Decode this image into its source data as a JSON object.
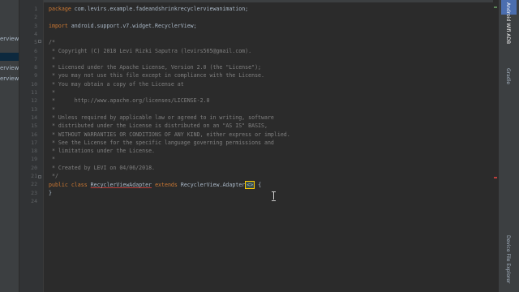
{
  "project_panel": {
    "items": [
      "erviewa",
      "erviewa",
      "erviewa"
    ]
  },
  "right_toolbar": {
    "tabs": [
      "Android Wifi ADB",
      "Gradle",
      "Device File Explorer"
    ]
  },
  "editor": {
    "line_numbers": [
      "1",
      "2",
      "3",
      "4",
      "5",
      "6",
      "7",
      "8",
      "9",
      "10",
      "11",
      "12",
      "13",
      "14",
      "15",
      "16",
      "17",
      "18",
      "19",
      "20",
      "21",
      "22",
      "23",
      "24"
    ],
    "package_keyword": "package",
    "package_name": " com.levirs.example.fadeandshrinkrecyclerviewanimation;",
    "import_keyword": "import",
    "import_name": " android.support.v7.widget.RecyclerView;",
    "comment_lines": [
      "/*",
      " * Copyright (C) 2018 Levi Rizki Saputra (levirs565@gmail.com).",
      " *",
      " * Licensed under the Apache License, Version 2.0 (the \"License\");",
      " * you may not use this file except in compliance with the License.",
      " * You may obtain a copy of the License at",
      " *",
      " *      http://www.apache.org/licenses/LICENSE-2.0",
      " *",
      " * Unless required by applicable law or agreed to in writing, software",
      " * distributed under the License is distributed on an \"AS IS\" BASIS,",
      " * WITHOUT WARRANTIES OR CONDITIONS OF ANY KIND, either express or implied.",
      " * See the License for the specific language governing permissions and",
      " * limitations under the License.",
      " *",
      " * Created by LEVI on 04/06/2018.",
      " */"
    ],
    "class_public": "public",
    "class_keyword": "class",
    "class_name": "RecyclerViewAdapter",
    "extends_keyword": "extends",
    "super_type": "RecyclerView.Adapter",
    "generic": "<>",
    "open_brace": " {",
    "close_brace": "}"
  }
}
